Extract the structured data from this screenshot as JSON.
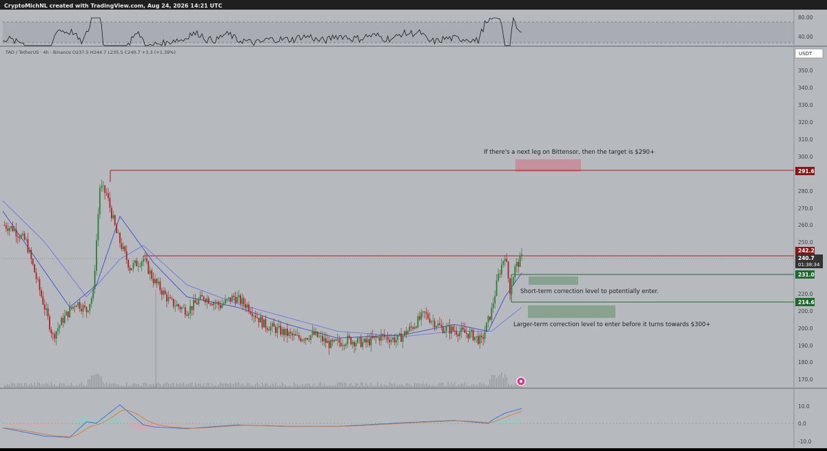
{
  "header": {
    "credit": "CryptoMichNL created with TradingView.com, Aug 24, 2026 14:21 UTC"
  },
  "symbol_info": {
    "pair": "TAO / TetherUS · 4h · Binance",
    "ohlc": "O237.5 H244.7 L235.5 C240.7 +3.3 (+1.39%)"
  },
  "colors": {
    "background": "#b6b9be",
    "rsi_line": "#1a1a1a",
    "resistance_line": "#b01c1c",
    "support_line": "#1d6b2c",
    "red_zone": "#c98a96",
    "green_zone": "#7f9d86",
    "up_candle": "#2e7d32",
    "down_candle": "#b02020",
    "ma_fast": "#3b4fd0",
    "ma_slow": "#6a78e0",
    "macd_line": "#2d6fe0",
    "signal_line": "#e0782d"
  },
  "rsi_panel": {
    "ticks": [
      "80.00",
      "40.00"
    ]
  },
  "price_axis": {
    "currency": "USDT",
    "ticks": [
      "350.0",
      "340.0",
      "330.0",
      "320.0",
      "310.0",
      "300.0",
      "290.0",
      "280.0",
      "270.0",
      "260.0",
      "250.0",
      "240.0",
      "230.0",
      "220.0",
      "210.0",
      "200.0",
      "190.0",
      "180.0",
      "170.0"
    ],
    "labels": {
      "level_high": "291.6",
      "level_mid": "242.2",
      "current": "240.7",
      "countdown": "01:38:34",
      "level_support_1": "231.0",
      "level_support_2": "214.6"
    }
  },
  "macd_panel": {
    "ticks": [
      "10.0",
      "0.0",
      "-10.0"
    ]
  },
  "annotations": {
    "target": "If there's a next leg on Bittensor, then the target is $290+",
    "short_term": "Short-term correction level to potentially enter.",
    "larger_term": "Larger-term correction level to enter before it turns towards $300+"
  },
  "chart_data": {
    "type": "candlestick",
    "title": "TAO / TetherUS · 4h · Binance",
    "ylim": [
      165,
      358
    ],
    "y_unit": "USDT",
    "last": {
      "open": 237.5,
      "high": 244.7,
      "low": 235.5,
      "close": 240.7,
      "change": 3.3,
      "change_pct": 1.39
    },
    "horizontal_levels": [
      {
        "price": 291.6,
        "role": "resistance"
      },
      {
        "price": 242.2,
        "role": "resistance"
      },
      {
        "price": 231.0,
        "role": "support"
      },
      {
        "price": 214.6,
        "role": "support"
      }
    ],
    "zones": [
      {
        "role": "target",
        "low": 290,
        "high": 298
      },
      {
        "role": "short_term_entry",
        "low": 224,
        "high": 229
      },
      {
        "role": "larger_term_entry",
        "low": 205,
        "high": 212
      }
    ],
    "price_path": [
      {
        "i": 0,
        "p": 260
      },
      {
        "i": 6,
        "p": 258
      },
      {
        "i": 14,
        "p": 250
      },
      {
        "i": 22,
        "p": 222
      },
      {
        "i": 30,
        "p": 195
      },
      {
        "i": 36,
        "p": 205
      },
      {
        "i": 44,
        "p": 215
      },
      {
        "i": 50,
        "p": 210
      },
      {
        "i": 54,
        "p": 220
      },
      {
        "i": 58,
        "p": 282
      },
      {
        "i": 62,
        "p": 278
      },
      {
        "i": 68,
        "p": 255
      },
      {
        "i": 76,
        "p": 235
      },
      {
        "i": 84,
        "p": 240
      },
      {
        "i": 90,
        "p": 228
      },
      {
        "i": 100,
        "p": 215
      },
      {
        "i": 110,
        "p": 210
      },
      {
        "i": 120,
        "p": 218
      },
      {
        "i": 130,
        "p": 213
      },
      {
        "i": 138,
        "p": 218
      },
      {
        "i": 146,
        "p": 213
      },
      {
        "i": 156,
        "p": 202
      },
      {
        "i": 166,
        "p": 198
      },
      {
        "i": 176,
        "p": 194
      },
      {
        "i": 186,
        "p": 196
      },
      {
        "i": 196,
        "p": 190
      },
      {
        "i": 206,
        "p": 193
      },
      {
        "i": 216,
        "p": 191
      },
      {
        "i": 226,
        "p": 195
      },
      {
        "i": 236,
        "p": 193
      },
      {
        "i": 244,
        "p": 200
      },
      {
        "i": 252,
        "p": 208
      },
      {
        "i": 262,
        "p": 200
      },
      {
        "i": 272,
        "p": 198
      },
      {
        "i": 280,
        "p": 196
      },
      {
        "i": 286,
        "p": 192
      },
      {
        "i": 292,
        "p": 210
      },
      {
        "i": 296,
        "p": 230
      },
      {
        "i": 300,
        "p": 243
      },
      {
        "i": 303,
        "p": 222
      },
      {
        "i": 306,
        "p": 235
      },
      {
        "i": 310,
        "p": 240.7
      }
    ],
    "ma_fast": [
      {
        "i": 0,
        "p": 268
      },
      {
        "i": 20,
        "p": 240
      },
      {
        "i": 40,
        "p": 212
      },
      {
        "i": 56,
        "p": 225
      },
      {
        "i": 70,
        "p": 265
      },
      {
        "i": 90,
        "p": 238
      },
      {
        "i": 110,
        "p": 218
      },
      {
        "i": 140,
        "p": 212
      },
      {
        "i": 170,
        "p": 202
      },
      {
        "i": 200,
        "p": 194
      },
      {
        "i": 240,
        "p": 196
      },
      {
        "i": 270,
        "p": 202
      },
      {
        "i": 290,
        "p": 198
      },
      {
        "i": 300,
        "p": 218
      },
      {
        "i": 310,
        "p": 232
      }
    ],
    "ma_slow": [
      {
        "i": 0,
        "p": 274
      },
      {
        "i": 25,
        "p": 250
      },
      {
        "i": 50,
        "p": 218
      },
      {
        "i": 70,
        "p": 240
      },
      {
        "i": 84,
        "p": 248
      },
      {
        "i": 110,
        "p": 225
      },
      {
        "i": 140,
        "p": 214
      },
      {
        "i": 170,
        "p": 206
      },
      {
        "i": 200,
        "p": 198
      },
      {
        "i": 240,
        "p": 195
      },
      {
        "i": 270,
        "p": 198
      },
      {
        "i": 292,
        "p": 198
      },
      {
        "i": 310,
        "p": 212
      }
    ],
    "rsi": {
      "ylim": [
        20,
        90
      ],
      "levels": [
        70,
        30
      ]
    },
    "macd": {
      "ylim": [
        -14,
        14
      ]
    }
  }
}
